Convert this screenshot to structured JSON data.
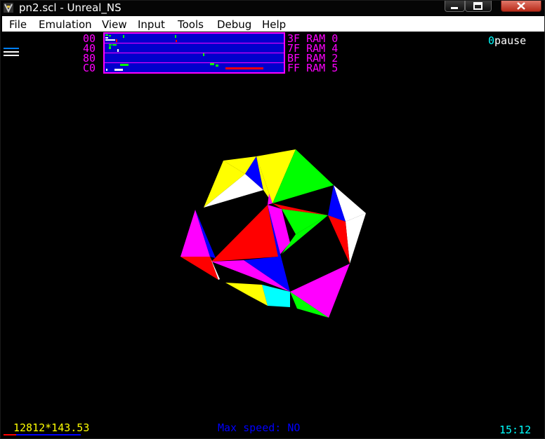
{
  "window": {
    "title": "pn2.scl - Unreal_NS"
  },
  "menu": {
    "file": "File",
    "emulation": "Emulation",
    "view": "View",
    "input": "Input",
    "tools": "Tools",
    "debug": "Debug",
    "help": "Help"
  },
  "memory_map": {
    "left_labels": [
      "00",
      "40",
      "80",
      "C0"
    ],
    "right_labels": [
      "3F RAM 0",
      "7F RAM 4",
      "BF RAM 2",
      "FF RAM 5"
    ]
  },
  "overlay": {
    "count": "0",
    "pause": "pause"
  },
  "status": {
    "left": "12812*143.53",
    "middle": "Max speed: NO",
    "time": "15:12"
  },
  "colors": {
    "magenta": "#ff00ff",
    "yellow": "#ffff00",
    "cyan": "#00ffff",
    "blue": "#0000ff",
    "red": "#ff0000",
    "green": "#00ff00",
    "white": "#ffffff"
  }
}
